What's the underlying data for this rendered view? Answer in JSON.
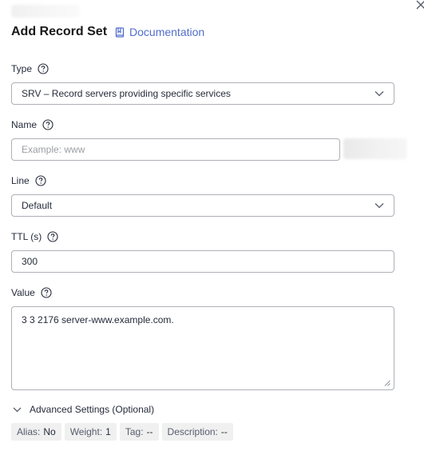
{
  "dialog": {
    "title": "Add Record Set",
    "documentation_label": "Documentation"
  },
  "form": {
    "type": {
      "label": "Type",
      "value": "SRV – Record servers providing specific services"
    },
    "name": {
      "label": "Name",
      "placeholder": "Example: www"
    },
    "line": {
      "label": "Line",
      "value": "Default"
    },
    "ttl": {
      "label": "TTL (s)",
      "value": "300"
    },
    "value": {
      "label": "Value",
      "value": "3 3 2176 server-www.example.com."
    }
  },
  "advanced": {
    "label": "Advanced Settings (Optional)",
    "summary": [
      {
        "key": "Alias:",
        "value": "No"
      },
      {
        "key": "Weight:",
        "value": "1"
      },
      {
        "key": "Tag:",
        "value": "--"
      },
      {
        "key": "Description:",
        "value": "--"
      }
    ]
  },
  "colors": {
    "link": "#526ecc",
    "border": "#adb0b8",
    "text": "#252b3a",
    "tag_bg": "#f0f0f0"
  },
  "icons": [
    "close-icon",
    "book-icon",
    "help-circle-icon",
    "chevron-down-icon",
    "resize-handle-icon"
  ]
}
